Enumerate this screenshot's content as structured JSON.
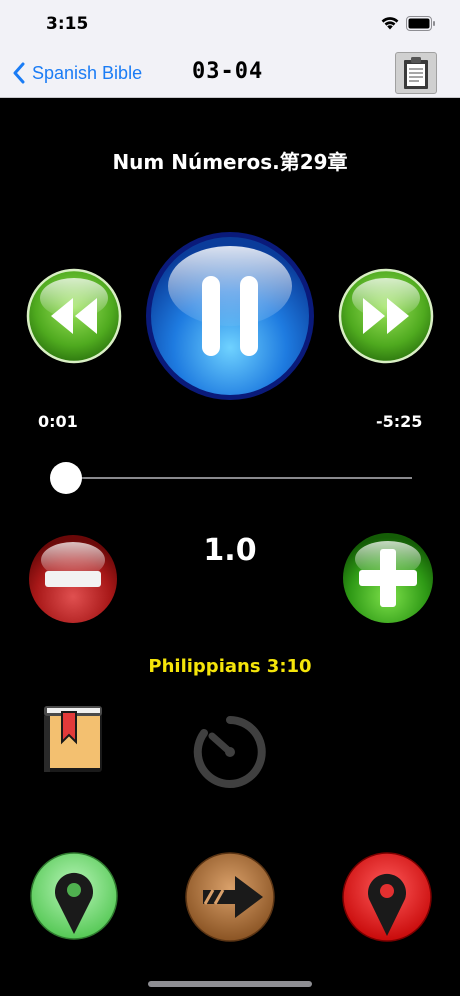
{
  "status_bar": {
    "time": "3:15"
  },
  "nav_bar": {
    "back_label": "Spanish Bible",
    "title": "03-04"
  },
  "player": {
    "track_title": "Num Números.第29章",
    "elapsed": "0:01",
    "remaining": "-5:25",
    "progress_fraction": 0.003,
    "speed": "1.0",
    "verse": "Philippians 3:10"
  },
  "colors": {
    "back_link": "#1a7cf5",
    "verse_text": "#f5e50a",
    "green_button": "#5cbf2a",
    "blue_button": "#1e7be0",
    "red_button": "#b02020",
    "brown_button": "#a86a35",
    "background": "#000000"
  },
  "icons": {
    "rewind": "rewind-icon",
    "pause": "pause-icon",
    "fast_forward": "fast-forward-icon",
    "minus": "minus-icon",
    "plus": "plus-icon",
    "bookmark_book": "bookmark-book-icon",
    "timer": "timer-icon",
    "location_green": "location-pin-icon",
    "forward_arrow": "forward-arrow-icon",
    "location_red": "location-pin-icon"
  }
}
